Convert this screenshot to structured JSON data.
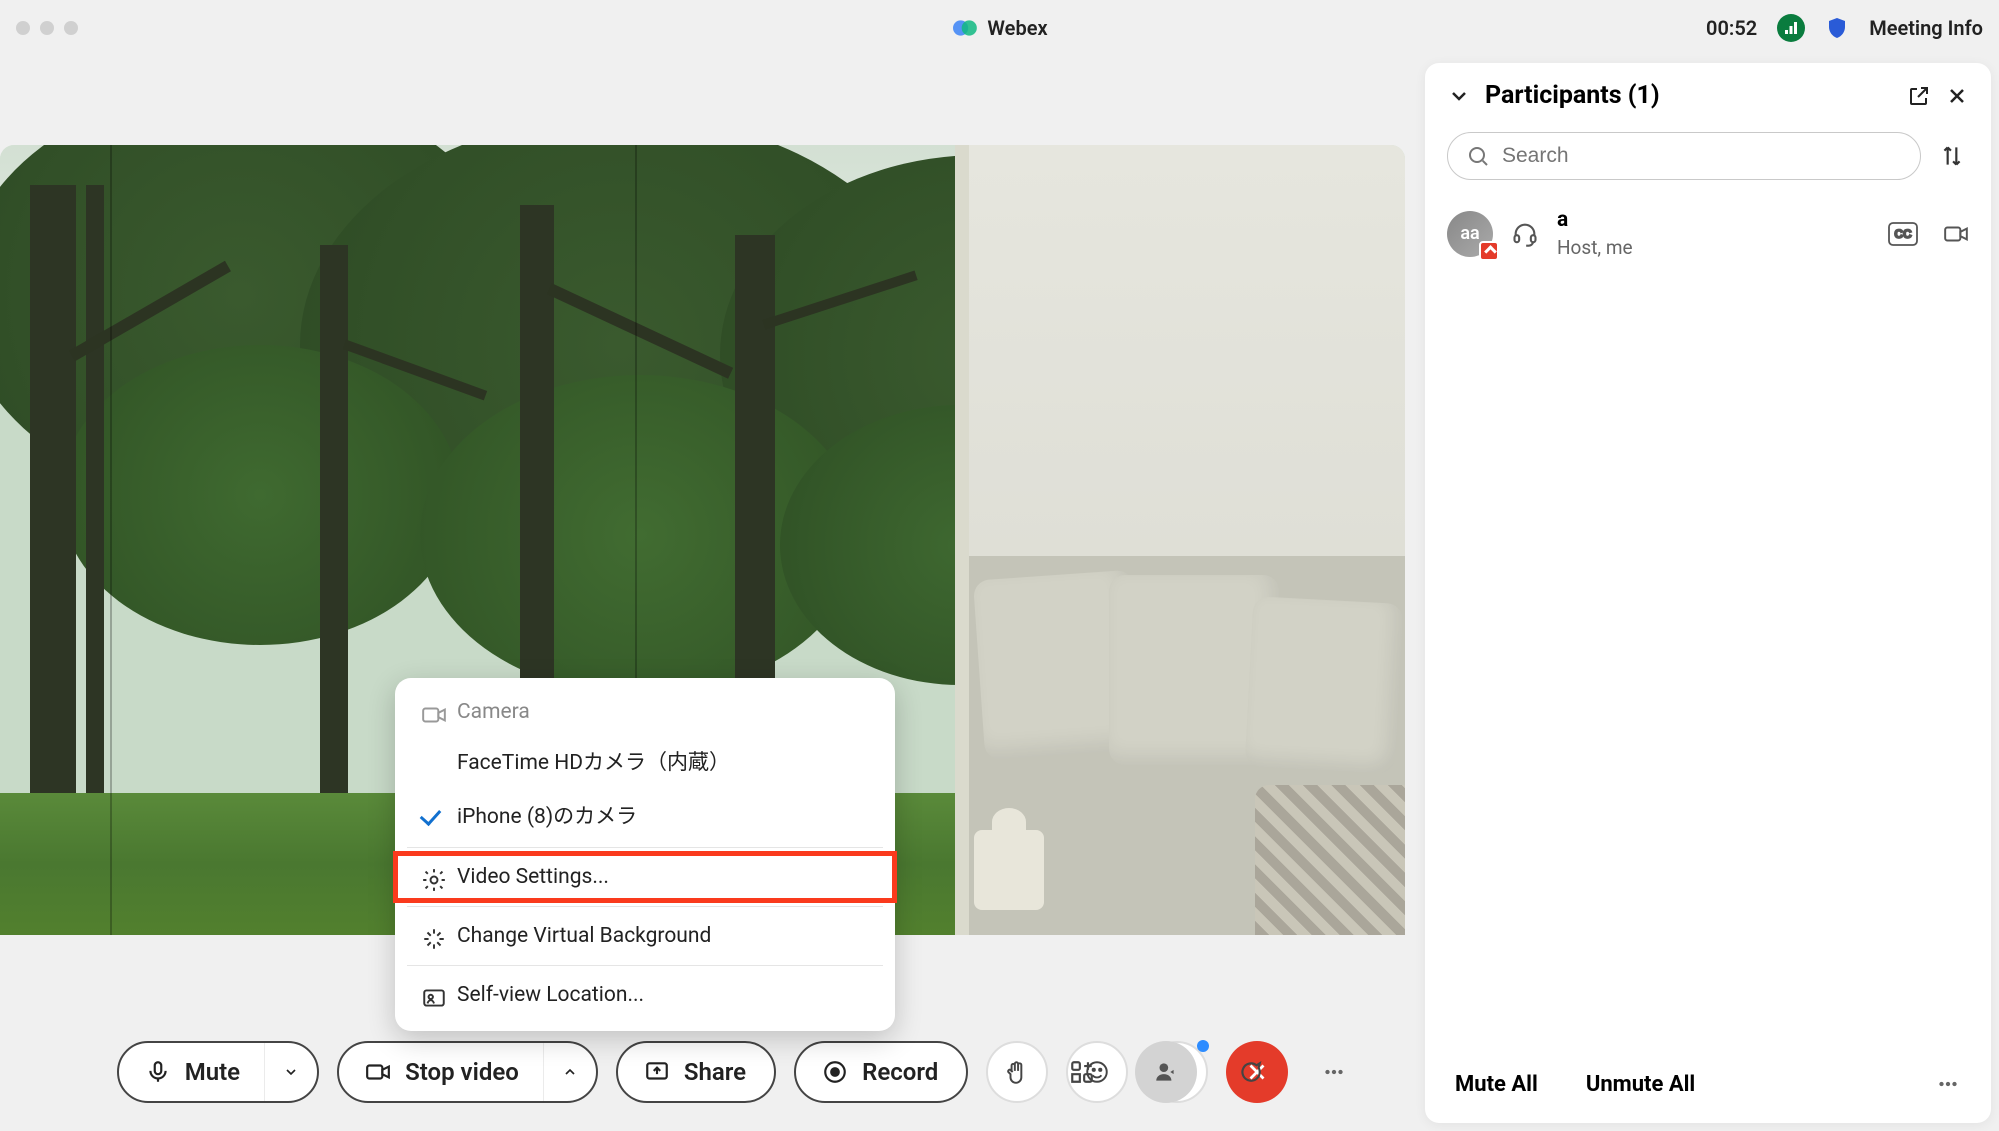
{
  "titlebar": {
    "app_name": "Webex",
    "timer": "00:52",
    "meeting_info": "Meeting Info"
  },
  "video_menu": {
    "section_label": "Camera",
    "items": {
      "facetime": "FaceTime HDカメラ（内蔵）",
      "iphone": "iPhone (8)のカメラ",
      "video_settings": "Video Settings...",
      "virtual_bg": "Change Virtual Background",
      "selfview": "Self-view Location..."
    }
  },
  "toolbar": {
    "mute": "Mute",
    "stop_video": "Stop video",
    "share": "Share",
    "record": "Record"
  },
  "participants": {
    "title": "Participants (1)",
    "search_placeholder": "Search",
    "items": [
      {
        "avatar": "aa",
        "name": "a",
        "sub": "Host, me"
      }
    ],
    "mute_all": "Mute All",
    "unmute_all": "Unmute All"
  }
}
